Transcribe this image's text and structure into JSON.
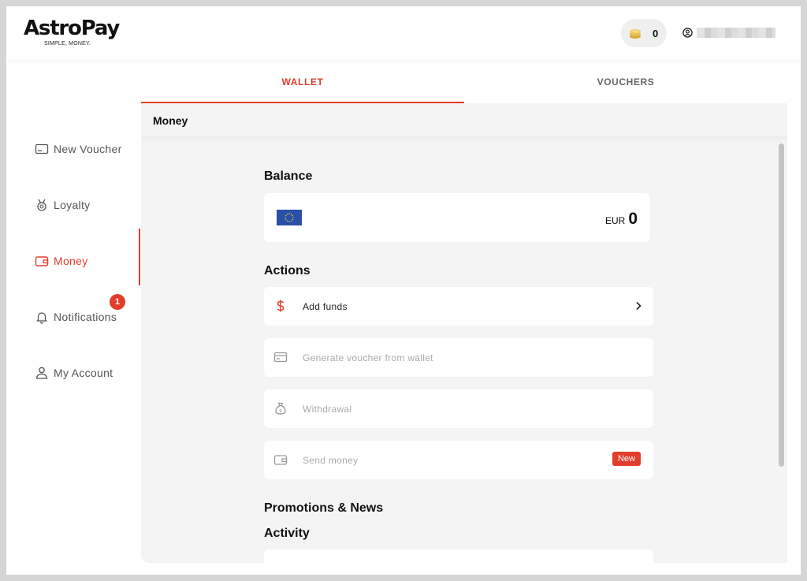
{
  "header": {
    "logo_text": "AstroPay",
    "logo_tagline": "SIMPLE, MONEY.",
    "coin_count": "0"
  },
  "sidebar": {
    "items": [
      {
        "label": "New Voucher",
        "icon": "voucher-card-icon"
      },
      {
        "label": "Loyalty",
        "icon": "medal-icon"
      },
      {
        "label": "Money",
        "icon": "wallet-icon",
        "active": true
      },
      {
        "label": "Notifications",
        "icon": "bell-icon",
        "badge": "1"
      },
      {
        "label": "My Account",
        "icon": "user-icon"
      }
    ]
  },
  "tabs": [
    {
      "label": "WALLET",
      "active": true
    },
    {
      "label": "VOUCHERS",
      "active": false
    }
  ],
  "content": {
    "title": "Money",
    "balance": {
      "heading": "Balance",
      "currency": "EUR",
      "amount": "0"
    },
    "actions_heading": "Actions",
    "actions": [
      {
        "label": "Add funds",
        "icon": "dollar-icon",
        "enabled": true
      },
      {
        "label": "Generate voucher from wallet",
        "icon": "card-icon",
        "enabled": false
      },
      {
        "label": "Withdrawal",
        "icon": "money-bag-icon",
        "enabled": false
      },
      {
        "label": "Send money",
        "icon": "wallet-icon",
        "enabled": false,
        "badge": "New"
      }
    ],
    "promotions_heading": "Promotions & News",
    "activity_heading": "Activity"
  },
  "colors": {
    "accent": "#e23c2b",
    "content_bg": "#f4f4f4",
    "flag_blue": "#2a4fa8"
  }
}
